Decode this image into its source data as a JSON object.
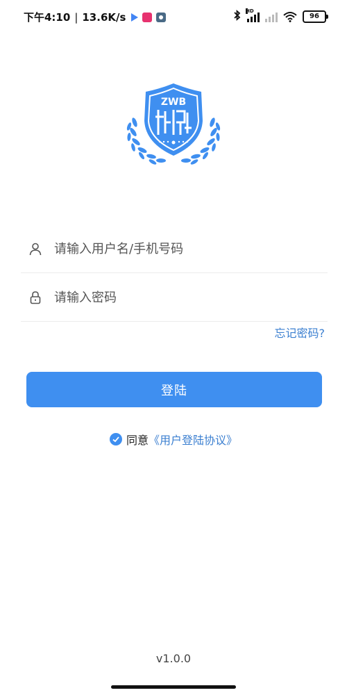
{
  "status_bar": {
    "time": "下午4:10",
    "divider": "|",
    "network_speed": "13.6K/s",
    "app_icons": [
      "play-icon",
      "app-store-icon",
      "settings-app-icon"
    ],
    "hd_label": "HD",
    "battery": "96"
  },
  "logo": {
    "text": "ZWB",
    "color": "#3f8ff0"
  },
  "login_form": {
    "username_placeholder": "请输入用户名/手机号码",
    "username_value": "",
    "password_placeholder": "请输入密码",
    "password_value": "",
    "forgot_password": "忘记密码?",
    "login_button": "登陆"
  },
  "agreement": {
    "checked": true,
    "prefix": "同意",
    "link_text": "《用户登陆协议》"
  },
  "footer": {
    "version": "v1.0.0"
  },
  "colors": {
    "primary": "#3f8ff0",
    "link": "#3b7fd0"
  }
}
